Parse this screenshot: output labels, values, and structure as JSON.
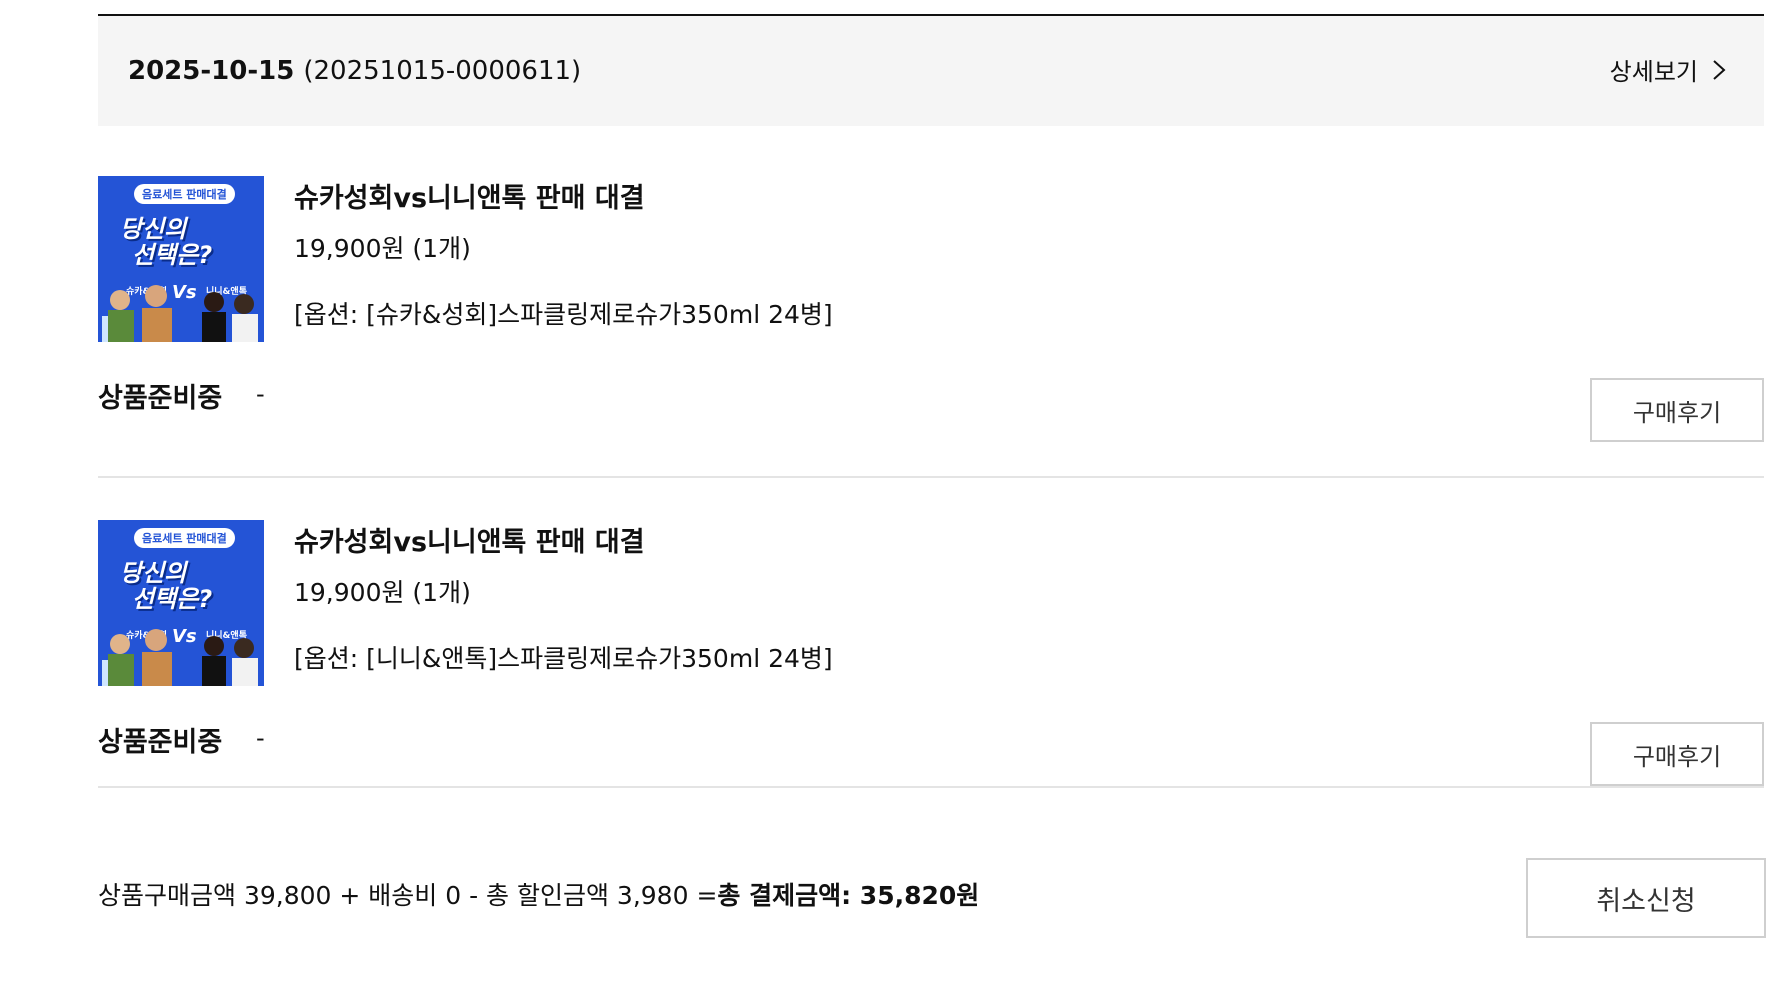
{
  "order": {
    "date": "2025-10-15",
    "number": "(20251015-0000611)",
    "detail_label": "상세보기"
  },
  "items": [
    {
      "thumb": {
        "badge": "음료세트 판매대결",
        "line1": "당신의",
        "line2": "선택은?",
        "left": "슈카&성회",
        "right": "니니&앤톡",
        "vs": "Vs"
      },
      "title": "슈카성회vs니니앤톡 판매 대결",
      "price": "19,900원 (1개)",
      "option": "[옵션: [슈카&성회]스파클링제로슈가350ml 24병]",
      "status": "상품준비중",
      "status_sub": "-",
      "review_label": "구매후기"
    },
    {
      "thumb": {
        "badge": "음료세트 판매대결",
        "line1": "당신의",
        "line2": "선택은?",
        "left": "슈카&성회",
        "right": "니니&앤톡",
        "vs": "Vs"
      },
      "title": "슈카성회vs니니앤톡 판매 대결",
      "price": "19,900원 (1개)",
      "option": "[옵션: [니니&앤톡]스파클링제로슈가350ml 24병]",
      "status": "상품준비중",
      "status_sub": "-",
      "review_label": "구매후기"
    }
  ],
  "summary": {
    "breakdown": "상품구매금액 39,800 + 배송비 0 - 총 할인금액 3,980 =",
    "total": "총 결제금액: 35,820원"
  },
  "cancel_label": "취소신청"
}
